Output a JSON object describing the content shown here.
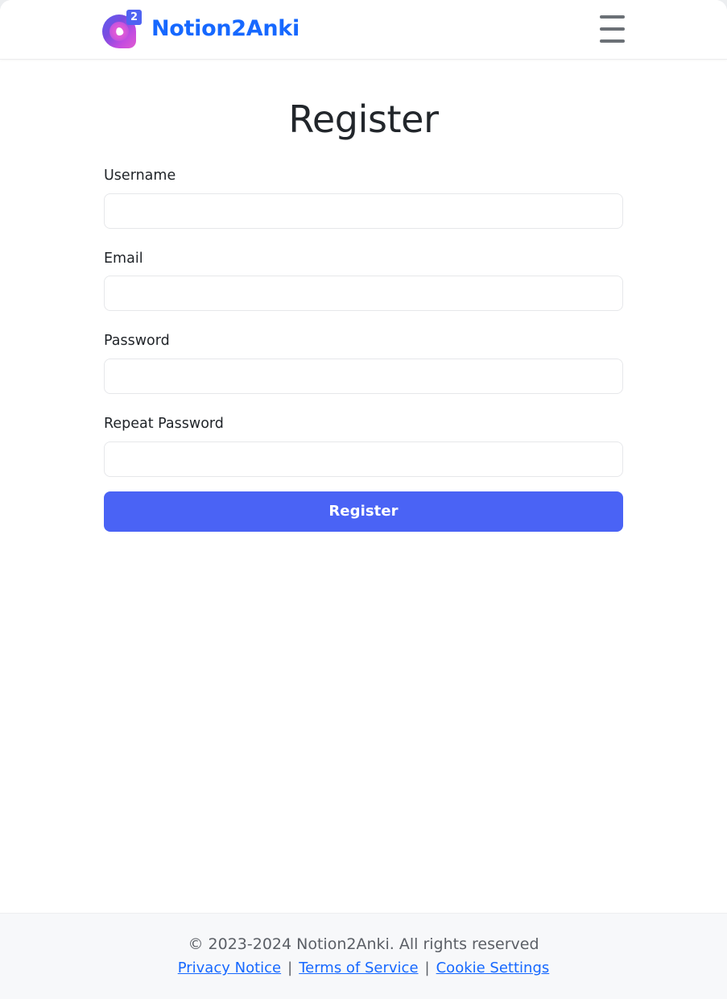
{
  "header": {
    "brand_name": "Notion2Anki",
    "logo_badge": "2",
    "logo_icon": "notion2anki-logo-icon",
    "menu_icon": "hamburger-menu-icon",
    "brand_color": "#1668ff"
  },
  "main": {
    "title": "Register",
    "fields": [
      {
        "label": "Username",
        "value": "",
        "placeholder": "",
        "type": "text",
        "name": "username"
      },
      {
        "label": "Email",
        "value": "",
        "placeholder": "",
        "type": "text",
        "name": "email"
      },
      {
        "label": "Password",
        "value": "",
        "placeholder": "",
        "type": "password",
        "name": "password"
      },
      {
        "label": "Repeat Password",
        "value": "",
        "placeholder": "",
        "type": "password",
        "name": "repeat-password"
      }
    ],
    "submit_label": "Register",
    "submit_color": "#4a63f5"
  },
  "footer": {
    "copyright": "© 2023-2024 Notion2Anki. All rights reserved",
    "links": [
      {
        "label": "Privacy Notice"
      },
      {
        "label": "Terms of Service"
      },
      {
        "label": "Cookie Settings"
      }
    ],
    "separator": "|",
    "link_color": "#1668ff"
  }
}
